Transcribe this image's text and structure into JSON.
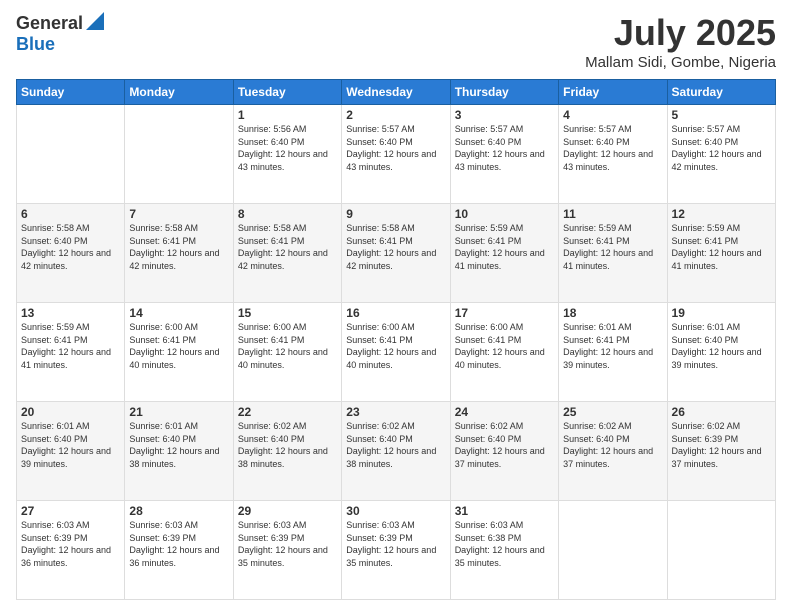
{
  "header": {
    "logo_line1": "General",
    "logo_line2": "Blue",
    "title": "July 2025",
    "subtitle": "Mallam Sidi, Gombe, Nigeria"
  },
  "days_of_week": [
    "Sunday",
    "Monday",
    "Tuesday",
    "Wednesday",
    "Thursday",
    "Friday",
    "Saturday"
  ],
  "weeks": [
    [
      {
        "day": "",
        "info": ""
      },
      {
        "day": "",
        "info": ""
      },
      {
        "day": "1",
        "info": "Sunrise: 5:56 AM\nSunset: 6:40 PM\nDaylight: 12 hours and 43 minutes."
      },
      {
        "day": "2",
        "info": "Sunrise: 5:57 AM\nSunset: 6:40 PM\nDaylight: 12 hours and 43 minutes."
      },
      {
        "day": "3",
        "info": "Sunrise: 5:57 AM\nSunset: 6:40 PM\nDaylight: 12 hours and 43 minutes."
      },
      {
        "day": "4",
        "info": "Sunrise: 5:57 AM\nSunset: 6:40 PM\nDaylight: 12 hours and 43 minutes."
      },
      {
        "day": "5",
        "info": "Sunrise: 5:57 AM\nSunset: 6:40 PM\nDaylight: 12 hours and 42 minutes."
      }
    ],
    [
      {
        "day": "6",
        "info": "Sunrise: 5:58 AM\nSunset: 6:40 PM\nDaylight: 12 hours and 42 minutes."
      },
      {
        "day": "7",
        "info": "Sunrise: 5:58 AM\nSunset: 6:41 PM\nDaylight: 12 hours and 42 minutes."
      },
      {
        "day": "8",
        "info": "Sunrise: 5:58 AM\nSunset: 6:41 PM\nDaylight: 12 hours and 42 minutes."
      },
      {
        "day": "9",
        "info": "Sunrise: 5:58 AM\nSunset: 6:41 PM\nDaylight: 12 hours and 42 minutes."
      },
      {
        "day": "10",
        "info": "Sunrise: 5:59 AM\nSunset: 6:41 PM\nDaylight: 12 hours and 41 minutes."
      },
      {
        "day": "11",
        "info": "Sunrise: 5:59 AM\nSunset: 6:41 PM\nDaylight: 12 hours and 41 minutes."
      },
      {
        "day": "12",
        "info": "Sunrise: 5:59 AM\nSunset: 6:41 PM\nDaylight: 12 hours and 41 minutes."
      }
    ],
    [
      {
        "day": "13",
        "info": "Sunrise: 5:59 AM\nSunset: 6:41 PM\nDaylight: 12 hours and 41 minutes."
      },
      {
        "day": "14",
        "info": "Sunrise: 6:00 AM\nSunset: 6:41 PM\nDaylight: 12 hours and 40 minutes."
      },
      {
        "day": "15",
        "info": "Sunrise: 6:00 AM\nSunset: 6:41 PM\nDaylight: 12 hours and 40 minutes."
      },
      {
        "day": "16",
        "info": "Sunrise: 6:00 AM\nSunset: 6:41 PM\nDaylight: 12 hours and 40 minutes."
      },
      {
        "day": "17",
        "info": "Sunrise: 6:00 AM\nSunset: 6:41 PM\nDaylight: 12 hours and 40 minutes."
      },
      {
        "day": "18",
        "info": "Sunrise: 6:01 AM\nSunset: 6:41 PM\nDaylight: 12 hours and 39 minutes."
      },
      {
        "day": "19",
        "info": "Sunrise: 6:01 AM\nSunset: 6:40 PM\nDaylight: 12 hours and 39 minutes."
      }
    ],
    [
      {
        "day": "20",
        "info": "Sunrise: 6:01 AM\nSunset: 6:40 PM\nDaylight: 12 hours and 39 minutes."
      },
      {
        "day": "21",
        "info": "Sunrise: 6:01 AM\nSunset: 6:40 PM\nDaylight: 12 hours and 38 minutes."
      },
      {
        "day": "22",
        "info": "Sunrise: 6:02 AM\nSunset: 6:40 PM\nDaylight: 12 hours and 38 minutes."
      },
      {
        "day": "23",
        "info": "Sunrise: 6:02 AM\nSunset: 6:40 PM\nDaylight: 12 hours and 38 minutes."
      },
      {
        "day": "24",
        "info": "Sunrise: 6:02 AM\nSunset: 6:40 PM\nDaylight: 12 hours and 37 minutes."
      },
      {
        "day": "25",
        "info": "Sunrise: 6:02 AM\nSunset: 6:40 PM\nDaylight: 12 hours and 37 minutes."
      },
      {
        "day": "26",
        "info": "Sunrise: 6:02 AM\nSunset: 6:39 PM\nDaylight: 12 hours and 37 minutes."
      }
    ],
    [
      {
        "day": "27",
        "info": "Sunrise: 6:03 AM\nSunset: 6:39 PM\nDaylight: 12 hours and 36 minutes."
      },
      {
        "day": "28",
        "info": "Sunrise: 6:03 AM\nSunset: 6:39 PM\nDaylight: 12 hours and 36 minutes."
      },
      {
        "day": "29",
        "info": "Sunrise: 6:03 AM\nSunset: 6:39 PM\nDaylight: 12 hours and 35 minutes."
      },
      {
        "day": "30",
        "info": "Sunrise: 6:03 AM\nSunset: 6:39 PM\nDaylight: 12 hours and 35 minutes."
      },
      {
        "day": "31",
        "info": "Sunrise: 6:03 AM\nSunset: 6:38 PM\nDaylight: 12 hours and 35 minutes."
      },
      {
        "day": "",
        "info": ""
      },
      {
        "day": "",
        "info": ""
      }
    ]
  ]
}
